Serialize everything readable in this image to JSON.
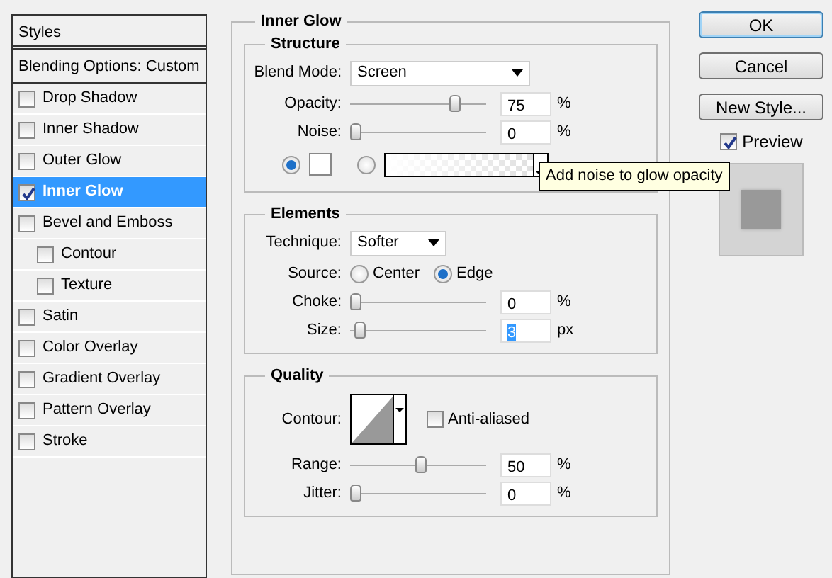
{
  "styles_panel": {
    "header": "Styles",
    "blending": "Blending Options: Custom",
    "items": [
      {
        "label": "Drop Shadow",
        "checked": false,
        "selected": false
      },
      {
        "label": "Inner Shadow",
        "checked": false,
        "selected": false
      },
      {
        "label": "Outer Glow",
        "checked": false,
        "selected": false
      },
      {
        "label": "Inner Glow",
        "checked": true,
        "selected": true
      },
      {
        "label": "Bevel and Emboss",
        "checked": false,
        "selected": false,
        "children": [
          {
            "label": "Contour",
            "checked": false,
            "selected": false
          },
          {
            "label": "Texture",
            "checked": false,
            "selected": false
          }
        ]
      },
      {
        "label": "Satin",
        "checked": false,
        "selected": false
      },
      {
        "label": "Color Overlay",
        "checked": false,
        "selected": false
      },
      {
        "label": "Gradient Overlay",
        "checked": false,
        "selected": false
      },
      {
        "label": "Pattern Overlay",
        "checked": false,
        "selected": false
      },
      {
        "label": "Stroke",
        "checked": false,
        "selected": false
      }
    ]
  },
  "effect": {
    "title": "Inner Glow",
    "sections": [
      {
        "title": "Structure",
        "rows": [
          {
            "kind": "select",
            "label": "Blend Mode:",
            "value": "Screen",
            "wide": true
          },
          {
            "kind": "slider",
            "label": "Opacity:",
            "level": 0.76,
            "value": "75",
            "unit": "%",
            "text_selected": false
          },
          {
            "kind": "slider",
            "label": "Noise:",
            "level": 0,
            "value": "0",
            "unit": "%",
            "text_selected": false
          },
          {
            "kind": "color",
            "options": [
              {
                "kind": "swatch",
                "selected": true
              },
              {
                "kind": "gradient",
                "selected": false
              }
            ]
          }
        ]
      },
      {
        "title": "Elements",
        "rows": [
          {
            "kind": "select",
            "label": "Technique:",
            "value": "Softer",
            "wide": false
          },
          {
            "kind": "radios",
            "label": "Source:",
            "options": [
              {
                "label": "Center",
                "selected": false
              },
              {
                "label": "Edge",
                "selected": true
              }
            ]
          },
          {
            "kind": "slider",
            "label": "Choke:",
            "level": 0,
            "value": "0",
            "unit": "%",
            "text_selected": false
          },
          {
            "kind": "slider",
            "label": "Size:",
            "level": 0.03,
            "value": "3",
            "unit": "px",
            "text_selected": true
          }
        ]
      },
      {
        "title": "Quality",
        "rows": [
          {
            "kind": "contour",
            "label": "Contour:",
            "checkbox": {
              "label": "Anti-aliased",
              "checked": false
            }
          },
          {
            "kind": "slider",
            "label": "Range:",
            "level": 0.5,
            "value": "50",
            "unit": "%",
            "text_selected": false
          },
          {
            "kind": "slider",
            "label": "Jitter:",
            "level": 0,
            "value": "0",
            "unit": "%",
            "text_selected": false
          }
        ]
      }
    ]
  },
  "tooltip": {
    "text": "Add noise to glow opacity"
  },
  "buttons": [
    {
      "label": "OK",
      "default": true
    },
    {
      "label": "Cancel",
      "default": false
    },
    {
      "label": "New Style...",
      "default": false
    }
  ],
  "preview": {
    "label": "Preview",
    "checked": true
  }
}
